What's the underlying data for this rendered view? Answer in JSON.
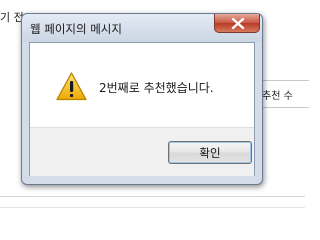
{
  "background": {
    "top_text": "기 전",
    "right_text": "추천 수"
  },
  "dialog": {
    "title": "웹 페이지의 메시지",
    "close_icon": "close-icon",
    "warning_icon": "warning-icon",
    "message": "2번째로 추천했습니다.",
    "ok_label": "확인",
    "colors": {
      "close_button": "#c75844",
      "warning_fill": "#f5c026",
      "title_gradient_top": "#e4ebf4"
    }
  }
}
